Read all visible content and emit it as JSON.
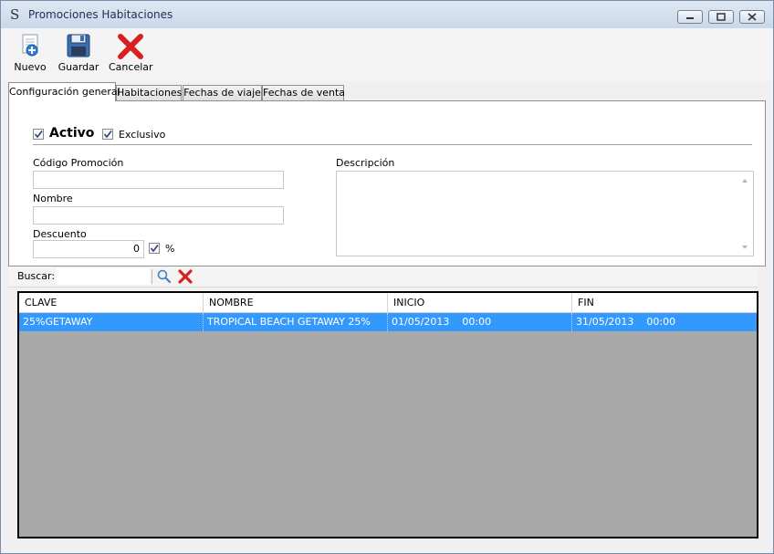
{
  "window": {
    "title": "Promociones Habitaciones",
    "app_icon": "S"
  },
  "toolbar": {
    "nuevo": "Nuevo",
    "guardar": "Guardar",
    "cancelar": "Cancelar"
  },
  "tabs": [
    {
      "label": "Configuración general",
      "active": true
    },
    {
      "label": "Habitaciones",
      "active": false
    },
    {
      "label": "Fechas de viaje",
      "active": false
    },
    {
      "label": "Fechas de venta",
      "active": false
    }
  ],
  "form": {
    "activo_label": "Activo",
    "activo_checked": true,
    "exclusivo_label": "Exclusivo",
    "exclusivo_checked": true,
    "codigo_label": "Código Promoción",
    "codigo_value": "",
    "nombre_label": "Nombre",
    "nombre_value": "",
    "descuento_label": "Descuento",
    "descuento_value": "0",
    "porcentaje_label": "%",
    "porcentaje_checked": true,
    "descripcion_label": "Descripción",
    "descripcion_value": ""
  },
  "search": {
    "label": "Buscar:",
    "value": ""
  },
  "grid": {
    "columns": [
      "CLAVE",
      "NOMBRE",
      "INICIO",
      "FIN"
    ],
    "rows": [
      {
        "clave": "25%GETAWAY",
        "nombre": "TROPICAL BEACH GETAWAY 25%",
        "inicio": "01/05/2013    00:00",
        "fin": "31/05/2013    00:00",
        "selected": true
      }
    ]
  },
  "colors": {
    "selection": "#3399ff",
    "grid_empty": "#a9a9a9",
    "cancel_red": "#d92020"
  }
}
